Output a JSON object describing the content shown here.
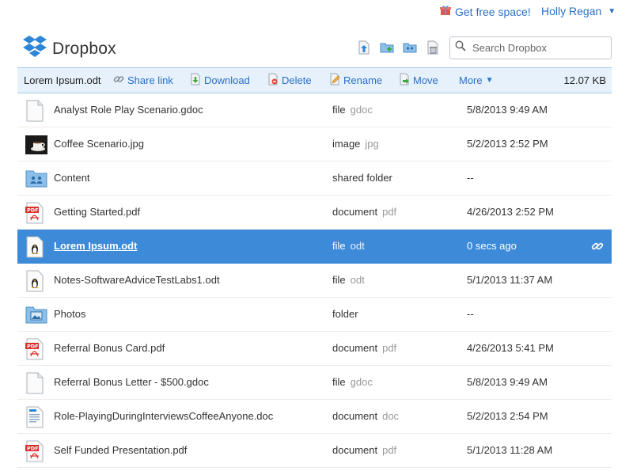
{
  "topbar": {
    "free_space": "Get free space!",
    "user_name": "Holly Regan"
  },
  "header": {
    "logo_text": "Dropbox",
    "search_placeholder": "Search Dropbox"
  },
  "actionbar": {
    "selected_name": "Lorem Ipsum.odt",
    "share_link": "Share link",
    "download": "Download",
    "delete": "Delete",
    "rename": "Rename",
    "move": "Move",
    "more": "More",
    "size": "12.07 KB"
  },
  "files": [
    {
      "name": "Analyst Role Play Scenario.gdoc",
      "type": "file",
      "ext": "gdoc",
      "date": "5/8/2013 9:49 AM",
      "icon": "document-icon"
    },
    {
      "name": "Coffee Scenario.jpg",
      "type": "image",
      "ext": "jpg",
      "date": "5/2/2013 2:52 PM",
      "icon": "image-thumbnail"
    },
    {
      "name": "Content",
      "type": "shared folder",
      "ext": "",
      "date": "--",
      "icon": "shared-folder-icon"
    },
    {
      "name": "Getting Started.pdf",
      "type": "document",
      "ext": "pdf",
      "date": "4/26/2013 2:52 PM",
      "icon": "pdf-icon"
    },
    {
      "name": "Lorem Ipsum.odt",
      "type": "file",
      "ext": "odt",
      "date": "0 secs ago",
      "icon": "linux-file-icon"
    },
    {
      "name": "Notes-SoftwareAdviceTestLabs1.odt",
      "type": "file",
      "ext": "odt",
      "date": "5/1/2013 11:37 AM",
      "icon": "linux-file-icon"
    },
    {
      "name": "Photos",
      "type": "folder",
      "ext": "",
      "date": "--",
      "icon": "photos-folder-icon"
    },
    {
      "name": "Referral Bonus Card.pdf",
      "type": "document",
      "ext": "pdf",
      "date": "4/26/2013 5:41 PM",
      "icon": "pdf-icon"
    },
    {
      "name": "Referral Bonus Letter - $500.gdoc",
      "type": "file",
      "ext": "gdoc",
      "date": "5/8/2013 9:49 AM",
      "icon": "document-icon"
    },
    {
      "name": "Role-PlayingDuringInterviewsCoffeeAnyone.doc",
      "type": "document",
      "ext": "doc",
      "date": "5/2/2013 2:54 PM",
      "icon": "word-doc-icon"
    },
    {
      "name": "Self Funded Presentation.pdf",
      "type": "document",
      "ext": "pdf",
      "date": "5/1/2013 11:28 AM",
      "icon": "pdf-icon"
    }
  ],
  "colors": {
    "accent": "#2a70c6",
    "selected_row": "#3d8ad8",
    "actionbar_bg": "#e6f1fb"
  }
}
